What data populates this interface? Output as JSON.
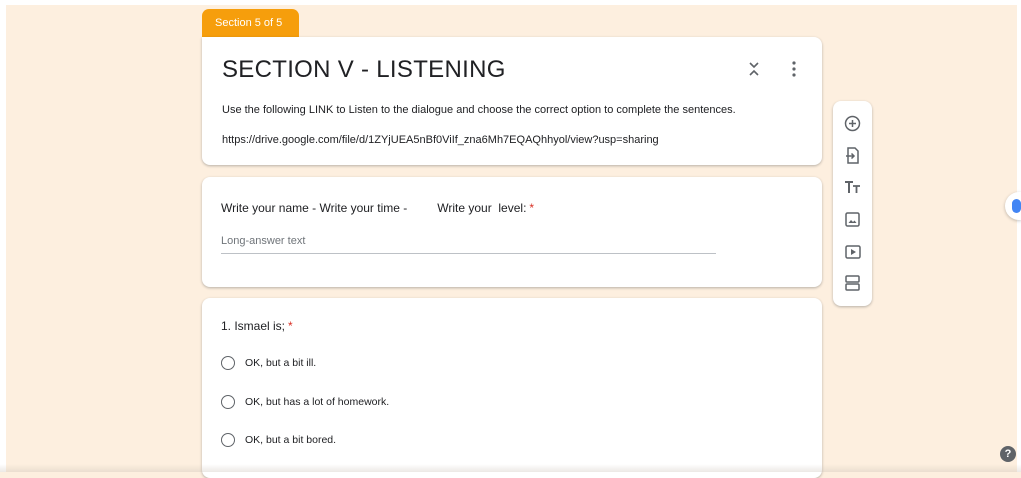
{
  "section_tab": {
    "label": "Section 5 of 5"
  },
  "header": {
    "title": "SECTION V - LISTENING",
    "description": "Use the following LINK to Listen to the dialogue and choose the correct option to complete the sentences.",
    "link": "https://drive.google.com/file/d/1ZYjUEA5nBf0ViIf_zna6Mh7EQAQhhyol/view?usp=sharing"
  },
  "question_1": {
    "label": "Write your name - Write your time -         Write your  level:",
    "required_mark": "*",
    "answer_placeholder": "Long-answer text"
  },
  "question_2": {
    "label": "1. Ismael is;",
    "required_mark": "*",
    "options": [
      "OK, but a bit ill.",
      "OK, but has a lot of homework.",
      "OK, but a bit bored."
    ]
  },
  "toolbar": {
    "tools": [
      "add-question-icon",
      "import-questions-icon",
      "add-title-icon",
      "add-image-icon",
      "add-video-icon",
      "add-section-icon"
    ]
  },
  "help": {
    "label": "?"
  },
  "colors": {
    "accent": "#f69e0c",
    "background": "#fdefdf",
    "required": "#d93025"
  }
}
